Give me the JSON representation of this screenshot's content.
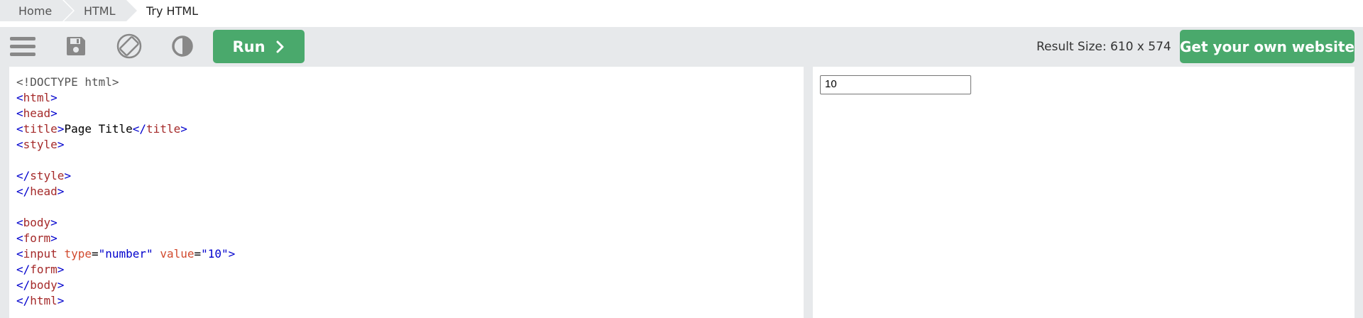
{
  "breadcrumb": {
    "items": [
      "Home",
      "HTML",
      "Try HTML"
    ]
  },
  "toolbar": {
    "icons": [
      "menu-icon",
      "save-icon",
      "rotate-icon",
      "contrast-icon"
    ],
    "run_label": "Run",
    "result_size": "Result Size: 610 x 574",
    "own_site_label": "Get your own website",
    "accent_color": "#4aa96c"
  },
  "editor": {
    "lines": [
      [
        {
          "c": "doc",
          "t": "<!DOCTYPE html>"
        }
      ],
      [
        {
          "c": "br",
          "t": "<"
        },
        {
          "c": "tag",
          "t": "html"
        },
        {
          "c": "br",
          "t": ">"
        }
      ],
      [
        {
          "c": "br",
          "t": "<"
        },
        {
          "c": "tag",
          "t": "head"
        },
        {
          "c": "br",
          "t": ">"
        }
      ],
      [
        {
          "c": "br",
          "t": "<"
        },
        {
          "c": "tag",
          "t": "title"
        },
        {
          "c": "br",
          "t": ">"
        },
        {
          "c": "txt",
          "t": "Page Title"
        },
        {
          "c": "br",
          "t": "</"
        },
        {
          "c": "tag",
          "t": "title"
        },
        {
          "c": "br",
          "t": ">"
        }
      ],
      [
        {
          "c": "br",
          "t": "<"
        },
        {
          "c": "tag",
          "t": "style"
        },
        {
          "c": "br",
          "t": ">"
        }
      ],
      [],
      [
        {
          "c": "br",
          "t": "</"
        },
        {
          "c": "tag",
          "t": "style"
        },
        {
          "c": "br",
          "t": ">"
        }
      ],
      [
        {
          "c": "br",
          "t": "</"
        },
        {
          "c": "tag",
          "t": "head"
        },
        {
          "c": "br",
          "t": ">"
        }
      ],
      [],
      [
        {
          "c": "br",
          "t": "<"
        },
        {
          "c": "tag",
          "t": "body"
        },
        {
          "c": "br",
          "t": ">"
        }
      ],
      [
        {
          "c": "br",
          "t": "<"
        },
        {
          "c": "tag",
          "t": "form"
        },
        {
          "c": "br",
          "t": ">"
        }
      ],
      [
        {
          "c": "br",
          "t": "<"
        },
        {
          "c": "tag",
          "t": "input"
        },
        {
          "c": "txt",
          "t": " "
        },
        {
          "c": "attr",
          "t": "type"
        },
        {
          "c": "txt",
          "t": "="
        },
        {
          "c": "val",
          "t": "\"number\""
        },
        {
          "c": "txt",
          "t": " "
        },
        {
          "c": "attr",
          "t": "value"
        },
        {
          "c": "txt",
          "t": "="
        },
        {
          "c": "val",
          "t": "\"10\""
        },
        {
          "c": "br",
          "t": ">"
        }
      ],
      [
        {
          "c": "br",
          "t": "</"
        },
        {
          "c": "tag",
          "t": "form"
        },
        {
          "c": "br",
          "t": ">"
        }
      ],
      [
        {
          "c": "br",
          "t": "</"
        },
        {
          "c": "tag",
          "t": "body"
        },
        {
          "c": "br",
          "t": ">"
        }
      ],
      [
        {
          "c": "br",
          "t": "</"
        },
        {
          "c": "tag",
          "t": "html"
        },
        {
          "c": "br",
          "t": ">"
        }
      ]
    ]
  },
  "result": {
    "number_input_value": "10"
  }
}
